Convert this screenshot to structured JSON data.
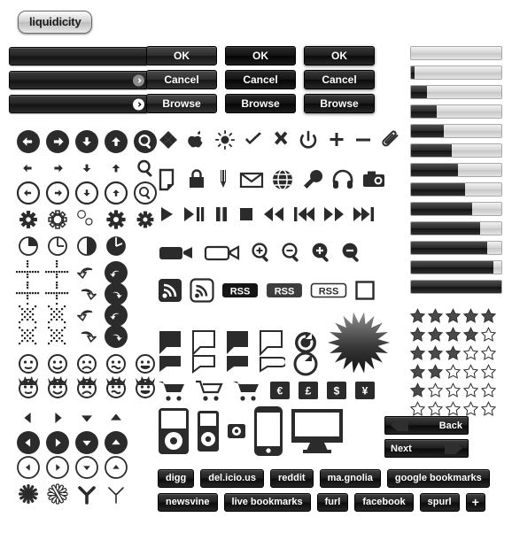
{
  "brand": {
    "label": "liquidicity"
  },
  "inputs": {
    "bars": [
      {
        "name": "text-input-plain",
        "has_go": false,
        "go_style": ""
      },
      {
        "name": "text-input-go-grey",
        "has_go": true,
        "go_style": "grey"
      },
      {
        "name": "text-input-go-white",
        "has_go": true,
        "go_style": "white"
      }
    ]
  },
  "buttons": {
    "columns": [
      {
        "style": "c1",
        "labels": [
          "OK",
          "Cancel",
          "Browse"
        ]
      },
      {
        "style": "c2",
        "labels": [
          "OK",
          "Cancel",
          "Browse"
        ]
      },
      {
        "style": "c3",
        "labels": [
          "OK",
          "Cancel",
          "Browse"
        ]
      }
    ]
  },
  "progress": {
    "values": [
      0,
      4,
      18,
      28,
      36,
      45,
      52,
      60,
      68,
      76,
      84,
      91,
      100
    ]
  },
  "ratings": {
    "max": 5,
    "rows": [
      5,
      4,
      3,
      2,
      1,
      0
    ]
  },
  "navigation": {
    "back_label": "Back",
    "next_label": "Next"
  },
  "social": {
    "row1": [
      "digg",
      "del.icio.us",
      "reddit",
      "ma.gnolia",
      "google bookmarks"
    ],
    "row2": [
      "newsvine",
      "live bookmarks",
      "furl",
      "facebook",
      "spurl",
      "+"
    ]
  },
  "currency": {
    "symbols": [
      "€",
      "£",
      "$",
      "¥"
    ]
  },
  "rss": {
    "badges": [
      "RSS",
      "RSS",
      "RSS"
    ]
  },
  "icons": {
    "left_grid": [
      [
        "arrow-left-circle-filled-icon",
        "arrow-right-circle-filled-icon",
        "arrow-down-circle-filled-icon",
        "arrow-up-circle-filled-icon",
        "search-circle-filled-icon"
      ],
      [
        "arrow-left-icon",
        "arrow-right-icon",
        "arrow-down-icon",
        "arrow-up-icon",
        "search-icon"
      ],
      [
        "arrow-left-circle-outline-icon",
        "arrow-right-circle-outline-icon",
        "arrow-down-circle-outline-icon",
        "arrow-up-circle-outline-icon",
        "search-circle-outline-icon"
      ],
      [
        "gear-filled-icon",
        "gear-outline-icon",
        "gears-outline-icon",
        "gear-large-icon",
        "gear-small-icon"
      ],
      [
        "clock-quarter-outline-icon",
        "clock-outline-icon",
        "pie-half-icon",
        "pie-filled-icon"
      ],
      [
        "cursor-move-dotted-icon",
        "cursor-move-dotted-small-icon",
        "arrow-curve-left-outline-icon",
        "arrow-curve-left-circle-icon"
      ],
      [
        "cursor-cross-dotted-icon",
        "cursor-cross-dotted-small-icon",
        "arrow-curve-right-outline-icon",
        "arrow-curve-right-circle-icon"
      ],
      [
        "cursor-diagonal-dotted-icon",
        "cursor-diagonal-dotted-small-icon",
        "arrow-curve-left-alt-icon",
        "arrow-curve-left-circle-alt-icon"
      ],
      [
        "cursor-diagonal-dotted-alt-icon",
        "cursor-diagonal-dotted-alt2-icon",
        "arrow-curve-right-alt-icon",
        "arrow-curve-right-circle-alt-icon"
      ],
      [
        "face-neutral-icon",
        "face-smile-icon",
        "face-sad-icon",
        "face-confused-icon",
        "face-grin-icon"
      ],
      [
        "face-hair-neutral-icon",
        "face-hair-smile-icon",
        "face-hair-sad-icon",
        "face-hair-confused-icon",
        "face-hair-grin-icon"
      ],
      [
        "triangle-left-icon",
        "triangle-right-icon",
        "triangle-down-icon",
        "triangle-up-icon"
      ],
      [
        "triangle-left-circle-filled-icon",
        "triangle-right-circle-filled-icon",
        "triangle-down-circle-filled-icon",
        "triangle-up-circle-filled-icon"
      ],
      [
        "triangle-left-circle-outline-icon",
        "triangle-right-circle-outline-icon",
        "triangle-down-circle-outline-icon",
        "triangle-up-circle-outline-icon"
      ],
      [
        "asterisk-filled-icon",
        "asterisk-outline-icon",
        "peace-filled-icon",
        "peace-outline-icon"
      ]
    ],
    "mid_grid": [
      [
        "windows-icon",
        "apple-icon",
        "sun-icon",
        "check-icon",
        "close-x-icon",
        "power-icon",
        "plus-icon",
        "minus-icon",
        "paperclip-icon"
      ],
      [
        "document-icon",
        "lock-icon",
        "pencil-icon",
        "mail-icon",
        "globe-icon",
        "wrench-icon",
        "headphones-icon",
        "camera-icon"
      ],
      [
        "play-icon",
        "play-pause-icon",
        "pause-icon",
        "stop-icon",
        "rewind-icon",
        "skip-back-icon",
        "fast-forward-icon",
        "skip-forward-icon"
      ],
      [
        "video-camera-filled-icon",
        "video-camera-outline-icon",
        "zoom-in-outline-icon",
        "zoom-out-outline-icon",
        "zoom-in-filled-icon",
        "zoom-out-filled-icon"
      ],
      [
        "rss-filled-icon",
        "rss-outline-icon",
        "rss-badge-dark-icon",
        "rss-badge-grey-icon",
        "rss-badge-outline-icon",
        "checkbox-empty-icon"
      ],
      [
        "speech-bubble-filled-icon",
        "speech-bubble-outline-icon",
        "speech-bubble-filled-tail-icon",
        "speech-bubble-outline-tail-icon",
        "refresh-circle-filled-icon",
        "starburst-icon"
      ],
      [
        "speech-bubble-flat-filled-icon",
        "speech-bubble-flat-outline-icon",
        "speech-bubble-flat-filled-alt-icon",
        "speech-bubble-flat-outline-alt-icon",
        "refresh-circle-outline-icon"
      ],
      [
        "cart-filled-icon",
        "cart-outline-icon",
        "cart-filled-alt-icon",
        "currency-euro-icon",
        "currency-pound-icon",
        "currency-dollar-icon",
        "currency-yen-icon"
      ],
      [
        "ipod-classic-icon",
        "ipod-nano-icon",
        "ipod-shuffle-icon",
        "iphone-icon",
        "monitor-icon"
      ]
    ]
  }
}
